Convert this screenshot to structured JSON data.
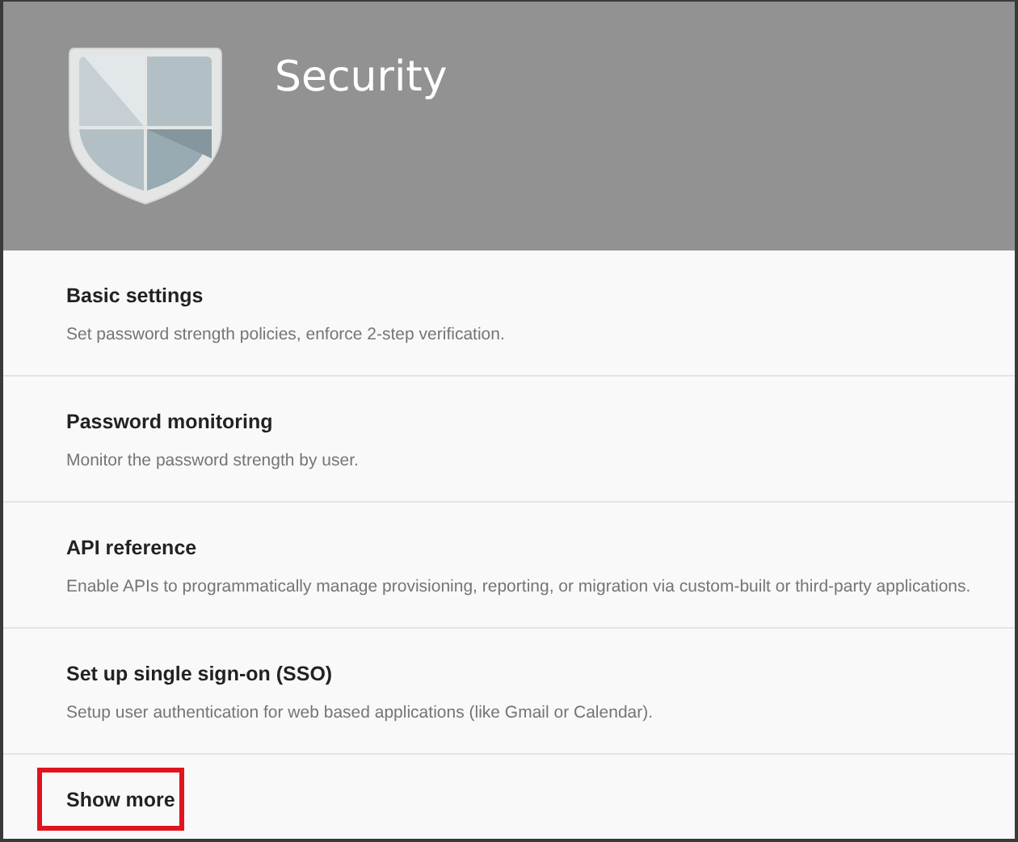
{
  "header": {
    "title": "Security"
  },
  "items": [
    {
      "title": "Basic settings",
      "description": "Set password strength policies, enforce 2-step verification."
    },
    {
      "title": "Password monitoring",
      "description": "Monitor the password strength by user."
    },
    {
      "title": "API reference",
      "description": "Enable APIs to programmatically manage provisioning, reporting, or migration via custom-built or third-party applications."
    },
    {
      "title": "Set up single sign-on (SSO)",
      "description": "Setup user authentication for web based applications (like Gmail or Calendar)."
    }
  ],
  "show_more": {
    "label": "Show more",
    "highlighted": true
  }
}
